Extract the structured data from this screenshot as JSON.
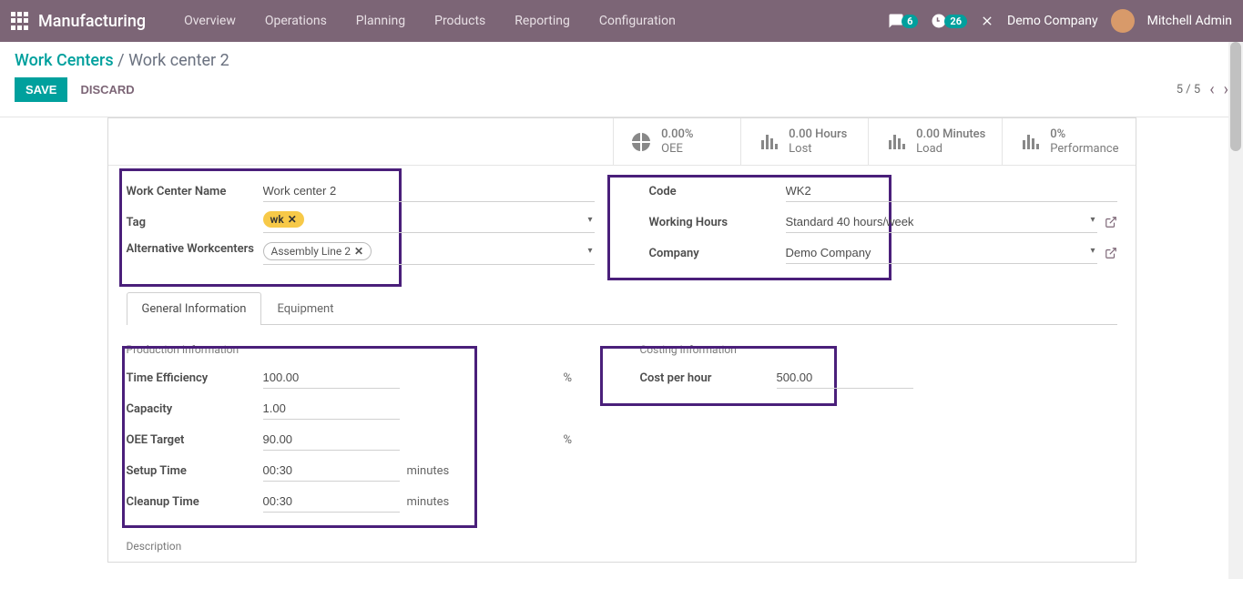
{
  "topbar": {
    "brand": "Manufacturing",
    "menu": [
      "Overview",
      "Operations",
      "Planning",
      "Products",
      "Reporting",
      "Configuration"
    ],
    "chat_badge": "6",
    "activity_badge": "26",
    "company": "Demo Company",
    "user": "Mitchell Admin"
  },
  "breadcrumb": {
    "root": "Work Centers",
    "current": "Work center 2"
  },
  "buttons": {
    "save": "SAVE",
    "discard": "DISCARD"
  },
  "pager": {
    "text": "5 / 5"
  },
  "stats": {
    "oee": {
      "value": "0.00%",
      "label": "OEE"
    },
    "lost": {
      "value": "0.00 Hours",
      "label": "Lost"
    },
    "load": {
      "value": "0.00 Minutes",
      "label": "Load"
    },
    "perf": {
      "value": "0%",
      "label": "Performance"
    }
  },
  "fields": {
    "name_label": "Work Center Name",
    "name_value": "Work center 2",
    "tag_label": "Tag",
    "tag_value": "wk",
    "alt_label": "Alternative Workcenters",
    "alt_value": "Assembly Line 2",
    "code_label": "Code",
    "code_value": "WK2",
    "hours_label": "Working Hours",
    "hours_value": "Standard 40 hours/week",
    "company_label": "Company",
    "company_value": "Demo Company"
  },
  "tabs": {
    "general": "General Information",
    "equipment": "Equipment"
  },
  "prod": {
    "title": "Production Information",
    "eff_label": "Time Efficiency",
    "eff_value": "100.00",
    "eff_unit": "%",
    "cap_label": "Capacity",
    "cap_value": "1.00",
    "oee_label": "OEE Target",
    "oee_value": "90.00",
    "oee_unit": "%",
    "setup_label": "Setup Time",
    "setup_value": "00:30",
    "setup_unit": "minutes",
    "clean_label": "Cleanup Time",
    "clean_value": "00:30",
    "clean_unit": "minutes"
  },
  "cost": {
    "title": "Costing Information",
    "cph_label": "Cost per hour",
    "cph_value": "500.00"
  },
  "desc_label": "Description"
}
